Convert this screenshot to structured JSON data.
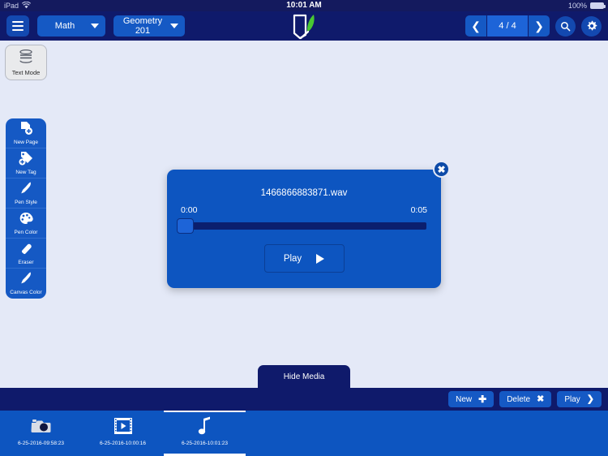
{
  "statusbar": {
    "device": "iPad",
    "wifi_icon": "wifi-icon",
    "time": "10:01 AM",
    "battery_percent": "100%",
    "battery_icon": "battery-icon"
  },
  "toolbar": {
    "menu_icon": "hamburger-menu-icon",
    "subject_dropdown": "Math",
    "course_dropdown": "Geometry 201",
    "brand_icon": "shield-quill-logo",
    "prev_icon": "chevron-left-icon",
    "page_indicator": "4 / 4",
    "next_icon": "chevron-right-icon",
    "search_icon": "search-icon",
    "settings_icon": "gear-icon"
  },
  "text_mode": {
    "label": "Text Mode",
    "icon": "text-lines-icon"
  },
  "palette": {
    "items": [
      {
        "label": "New Page",
        "icon": "page-plus-icon"
      },
      {
        "label": "New Tag",
        "icon": "tag-plus-icon"
      },
      {
        "label": "Pen Style",
        "icon": "pen-icon"
      },
      {
        "label": "Pen Color",
        "icon": "palette-icon"
      },
      {
        "label": "Eraser",
        "icon": "eraser-icon"
      },
      {
        "label": "Canvas Color",
        "icon": "brush-icon"
      }
    ]
  },
  "modal": {
    "filename": "1466866883871.wav",
    "current_time": "0:00",
    "total_time": "0:05",
    "play_label": "Play",
    "play_icon": "play-triangle-icon",
    "close_icon": "close-icon",
    "slider_value": 0
  },
  "hide_media": {
    "label": "Hide Media"
  },
  "media_actions": [
    {
      "label": "New",
      "icon": "plus-icon"
    },
    {
      "label": "Delete",
      "icon": "x-icon"
    },
    {
      "label": "Play",
      "icon": "chevron-right-icon"
    }
  ],
  "media_items": [
    {
      "caption": "6-25-2016-09:58:23",
      "icon": "camera-icon",
      "selected": false
    },
    {
      "caption": "6-25-2016-10:00:16",
      "icon": "film-icon",
      "selected": false
    },
    {
      "caption": "6-25-2016-10:01:23",
      "icon": "music-note-icon",
      "selected": true
    }
  ],
  "colors": {
    "statusbar_bg": "#141a5e",
    "toolbar_bg": "#0f1a6b",
    "accent_blue": "#1559c4",
    "canvas_bg": "#e4e9f7",
    "modal_bg": "#0d55c0",
    "track_navy": "#0b1f6e"
  }
}
